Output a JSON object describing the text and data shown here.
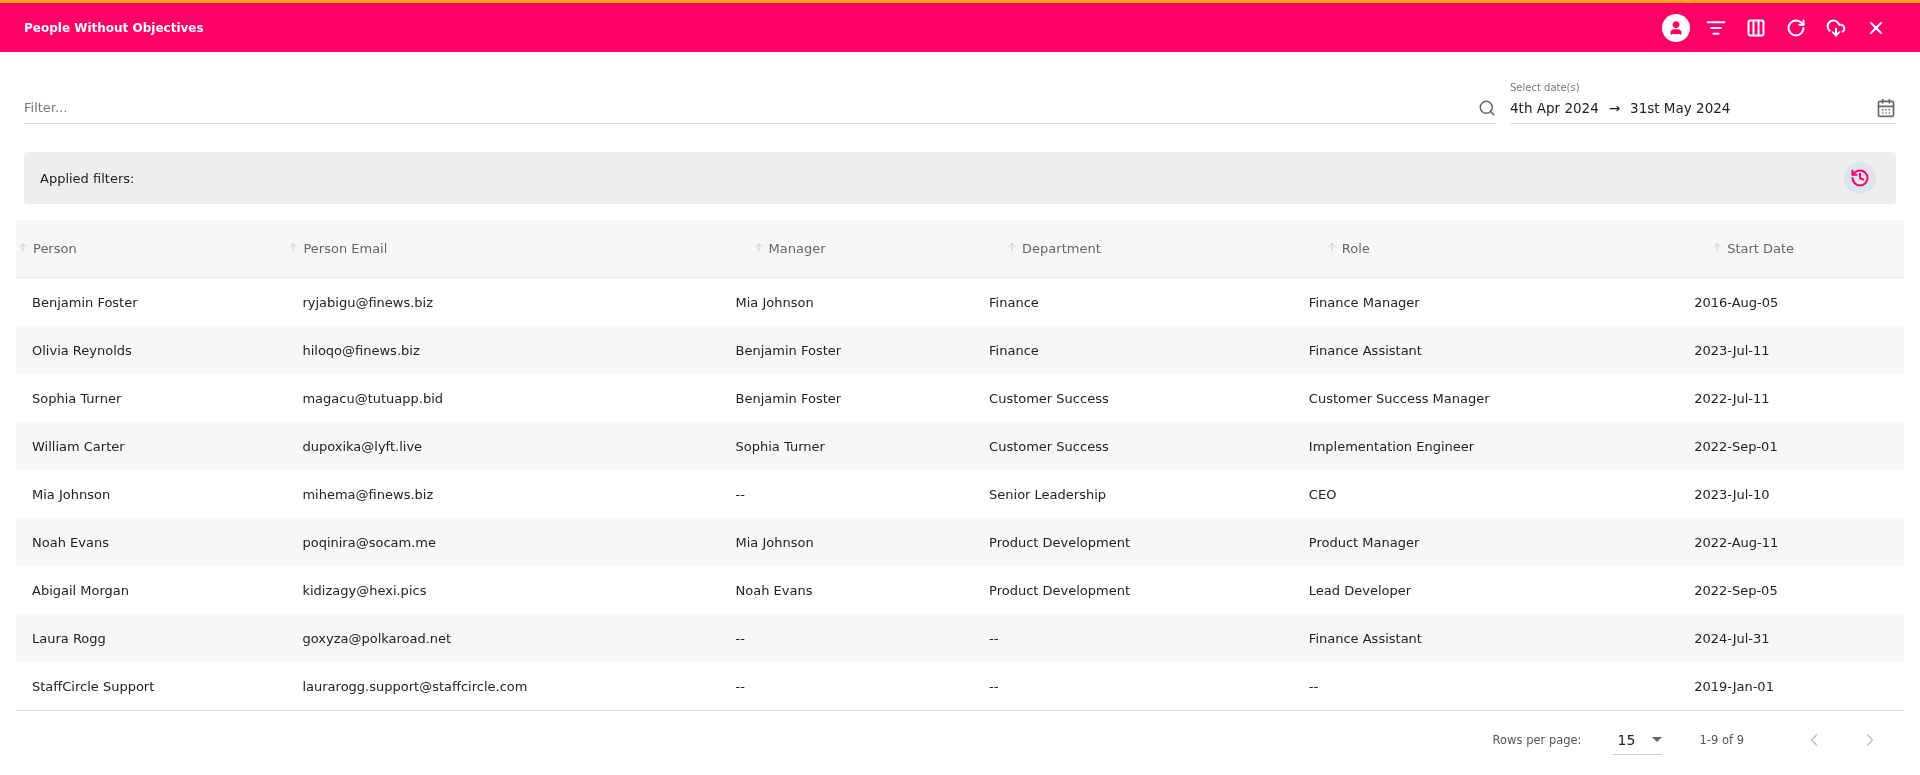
{
  "header": {
    "title": "People Without Objectives",
    "actions": [
      {
        "selected": true
      },
      {
        "selected": false
      },
      {
        "selected": false
      },
      {
        "selected": false
      },
      {
        "selected": false
      },
      {
        "selected": false
      }
    ]
  },
  "filter": {
    "placeholder": "Filter..."
  },
  "date_range": {
    "label": "Select date(s)",
    "start": "4th Apr 2024",
    "separator": "→",
    "end": "31st May 2024"
  },
  "applied_filters": {
    "label": "Applied filters:"
  },
  "table": {
    "columns": [
      "Person",
      "Person Email",
      "Manager",
      "Department",
      "Role",
      "Start Date"
    ],
    "rows": [
      [
        "Benjamin Foster",
        "ryjabigu@finews.biz",
        "Mia Johnson",
        "Finance",
        "Finance Manager",
        "2016-Aug-05"
      ],
      [
        "Olivia Reynolds",
        "hiloqo@finews.biz",
        "Benjamin Foster",
        "Finance",
        "Finance Assistant",
        "2023-Jul-11"
      ],
      [
        "Sophia Turner",
        "magacu@tutuapp.bid",
        "Benjamin Foster",
        "Customer Success",
        "Customer Success Manager",
        "2022-Jul-11"
      ],
      [
        "William Carter",
        "dupoxika@lyft.live",
        "Sophia Turner",
        "Customer Success",
        "Implementation Engineer",
        "2022-Sep-01"
      ],
      [
        "Mia Johnson",
        "mihema@finews.biz",
        "--",
        "Senior Leadership",
        "CEO",
        "2023-Jul-10"
      ],
      [
        "Noah Evans",
        "poqinira@socam.me",
        "Mia Johnson",
        "Product Development",
        "Product Manager",
        "2022-Aug-11"
      ],
      [
        "Abigail Morgan",
        "kidizagy@hexi.pics",
        "Noah Evans",
        "Product Development",
        "Lead Developer",
        "2022-Sep-05"
      ],
      [
        "Laura Rogg",
        "goxyza@polkaroad.net",
        "--",
        "--",
        "Finance Assistant",
        "2024-Jul-31"
      ],
      [
        "StaffCircle Support",
        "laurarogg.support@staffcircle.com",
        "--",
        "--",
        "--",
        "2019-Jan-01"
      ]
    ]
  },
  "pagination": {
    "rows_per_page_label": "Rows per page:",
    "rows_per_page": "15",
    "range": "1-9 of 9",
    "previous_disabled": true,
    "next_disabled": true
  }
}
